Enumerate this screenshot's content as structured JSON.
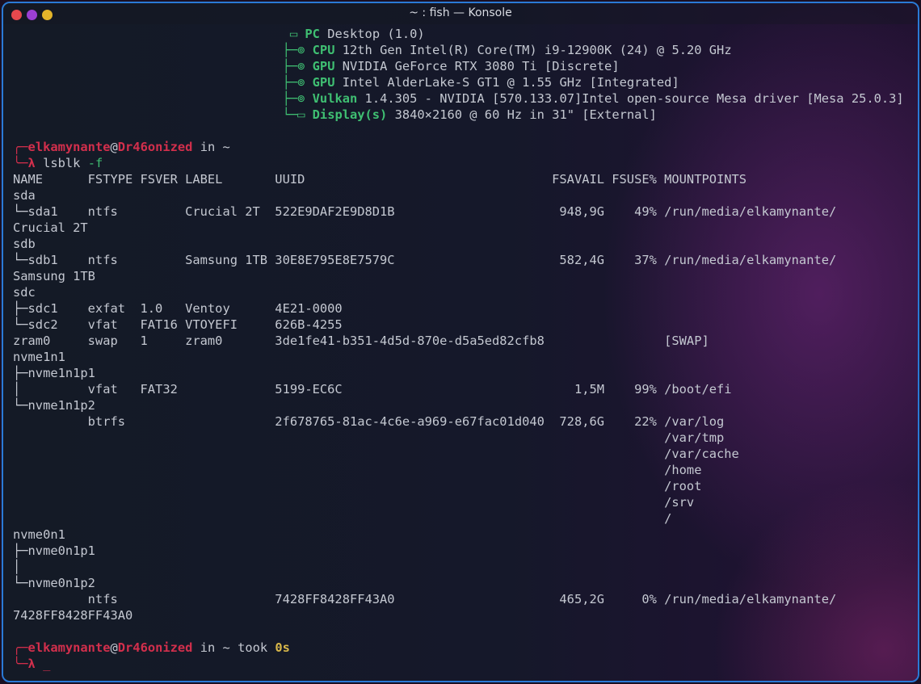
{
  "window": {
    "title": "~ : fish — Konsole"
  },
  "fastfetch": [
    {
      "label": "PC",
      "value": "Desktop (1.0)"
    },
    {
      "label": "CPU",
      "value": "12th Gen Intel(R) Core(TM) i9-12900K (24) @ 5.20 GHz"
    },
    {
      "label": "GPU",
      "value": "NVIDIA GeForce RTX 3080 Ti [Discrete]"
    },
    {
      "label": "GPU",
      "value": "Intel AlderLake-S GT1 @ 1.55 GHz [Integrated]"
    },
    {
      "label": "Vulkan",
      "value": "1.4.305 - NVIDIA [570.133.07]Intel open-source Mesa driver [Mesa 25.0.3]"
    },
    {
      "label": "Display(s)",
      "value": "3840×2160 @ 60 Hz in 31\" [External]"
    }
  ],
  "prompt1": {
    "user": "elkamynante",
    "at": "@",
    "host": "Dr46onized",
    "in": " in ",
    "cwd": "~",
    "lambda": "λ",
    "command": "lsblk",
    "flag": "-f"
  },
  "lsblk_header": "NAME      FSTYPE FSVER LABEL       UUID                                 FSAVAIL FSUSE% MOUNTPOINTS",
  "lsblk_lines": [
    "sda",
    "└─sda1    ntfs         Crucial 2T  522E9DAF2E9D8D1B                      948,9G    49% /run/media/elkamynante/",
    "Crucial 2T",
    "sdb",
    "└─sdb1    ntfs         Samsung 1TB 30E8E795E8E7579C                      582,4G    37% /run/media/elkamynante/",
    "Samsung 1TB",
    "sdc",
    "├─sdc1    exfat  1.0   Ventoy      4E21-0000",
    "└─sdc2    vfat   FAT16 VTOYEFI     626B-4255",
    "zram0     swap   1     zram0       3de1fe41-b351-4d5d-870e-d5a5ed82cfb8                [SWAP]",
    "nvme1n1",
    "├─nvme1n1p1",
    "│         vfat   FAT32             5199-EC6C                               1,5M    99% /boot/efi",
    "└─nvme1n1p2",
    "          btrfs                    2f678765-81ac-4c6e-a969-e67fac01d040  728,6G    22% /var/log",
    "                                                                                       /var/tmp",
    "                                                                                       /var/cache",
    "                                                                                       /home",
    "                                                                                       /root",
    "                                                                                       /srv",
    "                                                                                       /",
    "nvme0n1",
    "├─nvme0n1p1",
    "│",
    "└─nvme0n1p2",
    "          ntfs                     7428FF8428FF43A0                      465,2G     0% /run/media/elkamynante/",
    "7428FF8428FF43A0"
  ],
  "prompt2": {
    "user": "elkamynante",
    "at": "@",
    "host": "Dr46onized",
    "in": " in ",
    "cwd": "~",
    "took": " took ",
    "duration": "0s",
    "lambda": "λ",
    "cursor": "_"
  },
  "colors": {
    "accent_green": "#3fbf72",
    "accent_red": "#d22f4c",
    "accent_yellow": "#d9b84a",
    "window_border": "#2a7ad6"
  }
}
